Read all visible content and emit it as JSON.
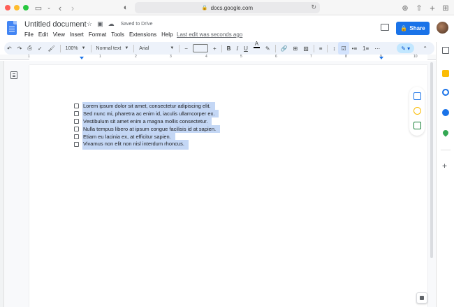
{
  "browser": {
    "url": "docs.google.com"
  },
  "header": {
    "doc_title": "Untitled document",
    "saved_status": "Saved to Drive",
    "menu": [
      "File",
      "Edit",
      "View",
      "Insert",
      "Format",
      "Tools",
      "Extensions",
      "Help"
    ],
    "last_edit": "Last edit was seconds ago",
    "share_label": "Share"
  },
  "toolbar": {
    "zoom": "100%",
    "style": "Normal text",
    "font": "Arial",
    "bold": "B",
    "italic": "I",
    "underline": "U",
    "text_color": "A"
  },
  "ruler": {
    "numbers": [
      "1",
      "1",
      "2",
      "3",
      "4",
      "5",
      "6",
      "7",
      "8",
      "9",
      "10"
    ]
  },
  "document": {
    "checklist": [
      "Lorem ipsum dolor sit amet, consectetur adipiscing elit.",
      "Sed nunc mi, pharetra ac enim id, iaculis ullamcorper ex.",
      "Vestibulum sit amet enim a magna mollis consectetur.",
      "Nulla tempus libero at ipsum congue facilisis id at sapien.",
      "Etiam eu lacinia ex, at efficitur sapien.",
      "Vivamus non elit non nisl interdum rhoncus."
    ]
  },
  "colors": {
    "accent": "#1a73e8",
    "selection": "#c4d7f5",
    "toolbar_bg": "#edf2fa"
  }
}
